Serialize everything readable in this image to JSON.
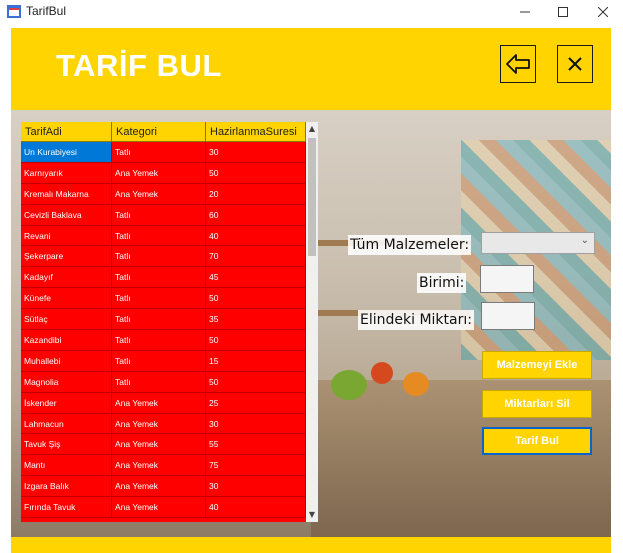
{
  "window": {
    "title": "TarifBul"
  },
  "header": {
    "title": "TARİF BUL"
  },
  "grid": {
    "columns": [
      "TarifAdi",
      "Kategori",
      "HazirlanmaSuresi"
    ],
    "rows": [
      [
        "Un Kurabiyesi",
        "Tatlı",
        "30"
      ],
      [
        "Karnıyarık",
        "Ana Yemek",
        "50"
      ],
      [
        "Kremalı Makarna",
        "Ana Yemek",
        "20"
      ],
      [
        "Cevizli Baklava",
        "Tatlı",
        "60"
      ],
      [
        "Revani",
        "Tatlı",
        "40"
      ],
      [
        "Şekerpare",
        "Tatlı",
        "70"
      ],
      [
        "Kadayıf",
        "Tatlı",
        "45"
      ],
      [
        "Künefe",
        "Tatlı",
        "50"
      ],
      [
        "Sütlaç",
        "Tatlı",
        "35"
      ],
      [
        "Kazandibi",
        "Tatlı",
        "50"
      ],
      [
        "Muhallebi",
        "Tatlı",
        "15"
      ],
      [
        "Magnolia",
        "Tatlı",
        "50"
      ],
      [
        "İskender",
        "Ana Yemek",
        "25"
      ],
      [
        "Lahmacun",
        "Ana Yemek",
        "30"
      ],
      [
        "Tavuk Şiş",
        "Ana Yemek",
        "55"
      ],
      [
        "Mantı",
        "Ana Yemek",
        "75"
      ],
      [
        "Izgara Balık",
        "Ana Yemek",
        "30"
      ],
      [
        "Fırında Tavuk",
        "Ana Yemek",
        "40"
      ]
    ]
  },
  "form": {
    "malzemeler_label": "Tüm Malzemeler:",
    "birim_label": "Birimi:",
    "miktar_label": "Elindeki Miktarı:"
  },
  "buttons": {
    "ekle": "Malzemeyi Ekle",
    "sil": "Miktarları Sil",
    "bul": "Tarif Bul"
  },
  "colors": {
    "accent": "#ffd400",
    "grid": "#ff0000",
    "selection": "#0078d7"
  }
}
